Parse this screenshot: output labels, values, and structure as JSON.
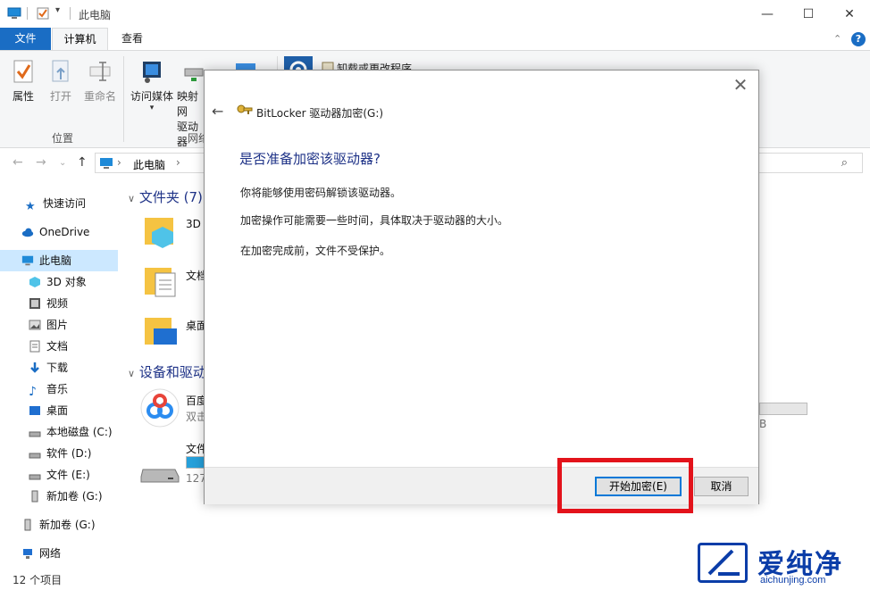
{
  "window": {
    "title": "此电脑",
    "minimize_glyph": "—",
    "maximize_glyph": "☐",
    "close_glyph": "✕"
  },
  "ribbon_tabs": {
    "file": "文件",
    "computer": "计算机",
    "view": "查看",
    "expand_glyph": "⌃",
    "help_glyph": "?"
  },
  "ribbon": {
    "buttons": [
      {
        "label": "属性",
        "icon": "properties-check-icon"
      },
      {
        "label": "打开",
        "icon": "open-icon"
      },
      {
        "label": "重命名",
        "icon": "rename-icon"
      },
      {
        "label": "访问媒体",
        "icon": "media-icon"
      },
      {
        "label": "映射网",
        "label2": "驱动器",
        "icon": "map-drive-icon"
      }
    ],
    "group_location": "位置",
    "group_network": "网络",
    "uninstall_label": "卸载或更改程序"
  },
  "address": {
    "path": "此电脑",
    "chevron": "›"
  },
  "nav": {
    "items": [
      {
        "label": "快速访问",
        "icon": "star-icon"
      },
      {
        "label": "OneDrive",
        "icon": "cloud-icon"
      },
      {
        "label": "此电脑",
        "icon": "computer-icon"
      },
      {
        "label": "3D 对象",
        "icon": "cube-icon"
      },
      {
        "label": "视频",
        "icon": "video-icon"
      },
      {
        "label": "图片",
        "icon": "picture-icon"
      },
      {
        "label": "文档",
        "icon": "document-icon"
      },
      {
        "label": "下载",
        "icon": "download-icon"
      },
      {
        "label": "音乐",
        "icon": "music-icon"
      },
      {
        "label": "桌面",
        "icon": "desktop-icon"
      },
      {
        "label": "本地磁盘 (C:)",
        "icon": "drive-icon"
      },
      {
        "label": "软件 (D:)",
        "icon": "drive-icon"
      },
      {
        "label": "文件 (E:)",
        "icon": "drive-icon"
      },
      {
        "label": "新加卷 (G:)",
        "icon": "usb-drive-icon"
      },
      {
        "label": "新加卷 (G:)",
        "icon": "usb-drive-icon"
      },
      {
        "label": "网络",
        "icon": "network-icon"
      }
    ]
  },
  "content": {
    "folders_header": "文件夹 (7)",
    "folder_items": [
      "3D",
      "文档",
      "桌面"
    ],
    "devices_header": "设备和驱动",
    "device_items": [
      {
        "name": "百度",
        "sub": "双击"
      },
      {
        "name": "文件",
        "sub": "127"
      }
    ],
    "right_fragment": "B"
  },
  "status": {
    "count": "12 个项目"
  },
  "dialog": {
    "title": "BitLocker 驱动器加密(G:)",
    "heading": "是否准备加密该驱动器?",
    "paragraphs": [
      "你将能够使用密码解锁该驱动器。",
      "加密操作可能需要一些时间，具体取决于驱动器的大小。",
      "在加密完成前，文件不受保护。"
    ],
    "start_button": "开始加密(E)",
    "cancel_button": "取消",
    "close_glyph": "✕",
    "back_glyph": "←"
  },
  "watermark": {
    "brand": "爱纯净",
    "url": "aichunjing.com"
  },
  "colors": {
    "accent": "#1a6dc4",
    "heading": "#1e3287",
    "highlight_frame": "#e3131b",
    "selected_nav": "#cce8ff"
  }
}
